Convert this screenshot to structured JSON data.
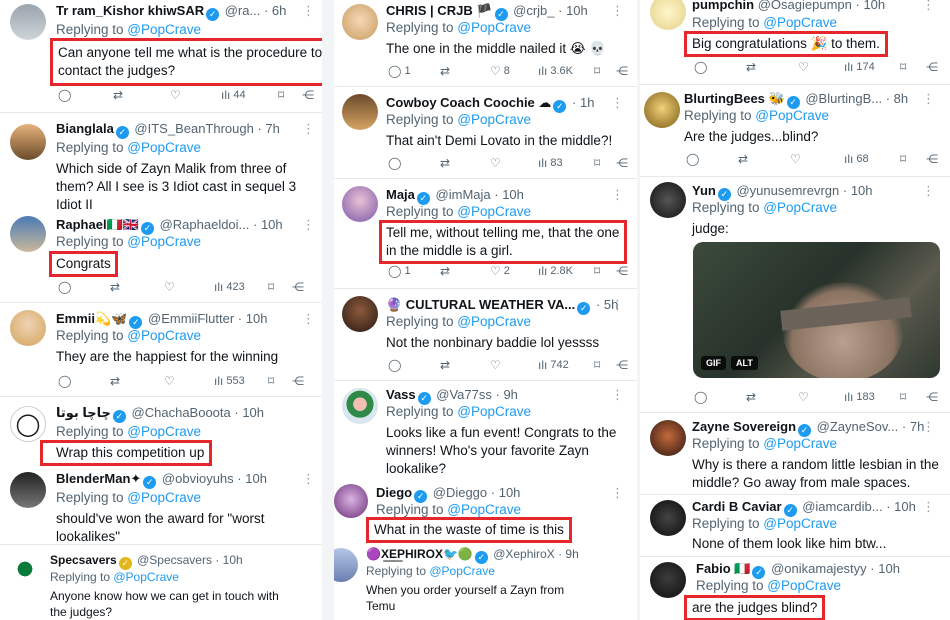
{
  "columns": [
    {
      "tweets": [
        {
          "name": "Tr ram_Kishor khiwSAR",
          "verified": true,
          "handle": "@ra...",
          "time": "· 6h",
          "replying": "Replying to ",
          "reply_to": "@PopCrave",
          "text": "Can anyone tell me what is the procedure to contact the judges?",
          "highlight": true,
          "replies": "",
          "retweets": "",
          "likes": "",
          "views": "44"
        },
        {
          "name": "Bianglala",
          "verified": true,
          "handle": "@ITS_BeanThrough",
          "time": "· 7h",
          "replying": "Replying to ",
          "reply_to": "@PopCrave",
          "text": "Which side of Zayn Malik from three of them? All I see is 3 Idiot cast in sequel 3 Idiot II",
          "highlight": false
        },
        {
          "name": "Raphael🇮🇹🇬🇧",
          "verified": true,
          "handle": "@Raphaeldoi...",
          "time": "· 10h",
          "replying": "Replying to ",
          "reply_to": "@PopCrave",
          "text": "Congrats",
          "highlight": true,
          "views": "423"
        },
        {
          "name": "Emmii💫🦋",
          "verified": true,
          "handle": "@EmmiiFlutter",
          "time": "· 10h",
          "replying": "Replying to ",
          "reply_to": "@PopCrave",
          "text": "They are the happiest for the winning",
          "highlight": false,
          "views": "553"
        },
        {
          "name": "چاچا بوتا",
          "verified": true,
          "handle": "@ChachaBooota",
          "time": "· 10h",
          "replying": "Replying to ",
          "reply_to": "@PopCrave",
          "text": "Wrap this competition up",
          "highlight": true
        },
        {
          "name": "BlenderMan✦",
          "verified": true,
          "handle": "@obvioyuhs",
          "time": "· 10h",
          "replying": "Replying to ",
          "reply_to": "@PopCrave",
          "text": "should've won the award for \"worst lookalikes\"",
          "highlight": false
        },
        {
          "name": "Specsavers",
          "verified": true,
          "gold": true,
          "handle": "@Specsavers",
          "time": "· 10h",
          "replying": "Replying to ",
          "reply_to": "@PopCrave",
          "text": "Anyone know how we can get in touch with the judges?",
          "highlight": false
        }
      ]
    },
    {
      "tweets": [
        {
          "name": "CHRIS | CRJB 🏴",
          "verified": true,
          "handle": "@crjb_",
          "time": "· 10h",
          "replying": "Replying to ",
          "reply_to": "@PopCrave",
          "text": "The one in the middle nailed it 😭 💀",
          "highlight": false,
          "replies": "1",
          "likes": "8",
          "views": "3.6K"
        },
        {
          "name": "Cowboy Coach Coochie ☁",
          "verified": true,
          "handle": "",
          "time": "· 1h",
          "replying": "Replying to ",
          "reply_to": "@PopCrave",
          "text": "That ain't Demi Lovato in the middle?!",
          "highlight": false,
          "views": "83"
        },
        {
          "name": "Maja",
          "verified": true,
          "handle": "@imMaja",
          "time": "· 10h",
          "replying": "Replying to ",
          "reply_to": "@PopCrave",
          "text": "Tell me, without telling me, that the one in the middle is a girl.",
          "highlight": true,
          "replies": "1",
          "likes": "2",
          "views": "2.8K"
        },
        {
          "name": "🔮 CULTURAL WEATHER VA...",
          "verified": true,
          "handle": "",
          "time": "· 5h",
          "replying": "Replying to ",
          "reply_to": "@PopCrave",
          "text": "Not the nonbinary baddie lol yessss",
          "highlight": false,
          "views": "742"
        },
        {
          "name": "Vass",
          "verified": true,
          "handle": "@Va77ss",
          "time": "· 9h",
          "replying": "Replying to ",
          "reply_to": "@PopCrave",
          "text": "Looks like a fun event! Congrats to the winners! Who's your favorite Zayn lookalike?",
          "highlight": false
        },
        {
          "name": "Diego",
          "verified": true,
          "handle": "@Dieggo",
          "time": "· 10h",
          "replying": "Replying to ",
          "reply_to": "@PopCrave",
          "text": "What in the waste of time is this",
          "highlight": true
        },
        {
          "name": "🟣X͟E͟PHIROX🐦🟢",
          "verified": true,
          "handle": "@XephiroX",
          "time": "· 9h",
          "replying": "Replying to ",
          "reply_to": "@PopCrave",
          "text": "When you order yourself a Zayn from Temu",
          "highlight": false
        }
      ]
    },
    {
      "tweets": [
        {
          "name": "pumpchin",
          "verified": false,
          "handle": "@Osagiepumpn",
          "time": "· 10h",
          "replying": "Replying to ",
          "reply_to": "@PopCrave",
          "text": "Big congratulations 🎉 to them.",
          "highlight": true,
          "views": "174"
        },
        {
          "name": "BlurtingBees 🐝",
          "verified": true,
          "handle": "@BlurtingB...",
          "time": "· 8h",
          "replying": "Replying to ",
          "reply_to": "@PopCrave",
          "text": "Are the judges...blind?",
          "highlight": false,
          "views": "68"
        },
        {
          "name": "Yun",
          "verified": true,
          "handle": "@yunusemrevrgn",
          "time": "· 10h",
          "replying": "Replying to ",
          "reply_to": "@PopCrave",
          "text": "judge:",
          "highlight": false,
          "views": "183",
          "gif": "GIF",
          "alt": "ALT"
        },
        {
          "name": "Zayne Sovereign",
          "verified": true,
          "handle": "@ZayneSov...",
          "time": "· 7h",
          "replying": "Replying to ",
          "reply_to": "@PopCrave",
          "text": "Why is there a random little lesbian in the middle? Go away from male spaces.",
          "highlight": false
        },
        {
          "name": "Cardi B Caviar",
          "verified": true,
          "handle": "@iamcardib...",
          "time": "· 10h",
          "replying": "Replying to ",
          "reply_to": "@PopCrave",
          "text": "None of them look like him btw...",
          "highlight": false
        },
        {
          "name": "Fabio 🇮🇹",
          "verified": true,
          "handle": "@onikamajestyy",
          "time": "· 10h",
          "replying": "Replying to ",
          "reply_to": "@PopCrave",
          "text": "are the judges blind?",
          "highlight": true
        }
      ]
    }
  ],
  "icons": {
    "reply": "💬",
    "retweet": "⇄",
    "like": "♡",
    "views": "📊",
    "bookmark": "🔖",
    "share": "⤴",
    "more": "⋮"
  },
  "colors": {
    "link": "#1d9bf0",
    "highlight": "#e5262b",
    "verified": "#1d9bf0",
    "muted": "#536471"
  }
}
